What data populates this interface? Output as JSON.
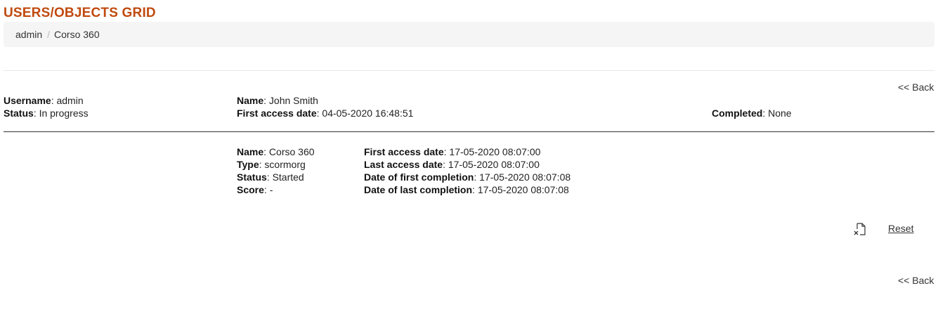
{
  "page_title": "USERS/OBJECTS GRID",
  "breadcrumb": [
    "admin",
    "Corso 360"
  ],
  "breadcrumb_separator": "/",
  "back_label": "<< Back",
  "user_info": {
    "username": {
      "label": "Username",
      "value": "admin"
    },
    "status": {
      "label": "Status",
      "value": "In progress"
    },
    "name": {
      "label": "Name",
      "value": "John Smith"
    },
    "first_access": {
      "label": "First access date",
      "value": "04-05-2020 16:48:51"
    },
    "completed": {
      "label": "Completed",
      "value": "None"
    }
  },
  "object_info": {
    "name": {
      "label": "Name",
      "value": "Corso 360"
    },
    "type": {
      "label": "Type",
      "value": "scormorg"
    },
    "status": {
      "label": "Status",
      "value": "Started"
    },
    "score": {
      "label": "Score",
      "value": "-"
    },
    "first_access": {
      "label": "First access date",
      "value": "17-05-2020 08:07:00"
    },
    "last_access": {
      "label": "Last access date",
      "value": "17-05-2020 08:07:00"
    },
    "first_completion": {
      "label": "Date of first completion",
      "value": "17-05-2020 08:07:08"
    },
    "last_completion": {
      "label": "Date of last completion",
      "value": "17-05-2020 08:07:08"
    }
  },
  "actions": {
    "reset_label": "Reset",
    "reset_icon": "file-remove-icon"
  },
  "colors": {
    "title": "#c04a0e",
    "breadcrumb_bg": "#f5f5f5"
  }
}
